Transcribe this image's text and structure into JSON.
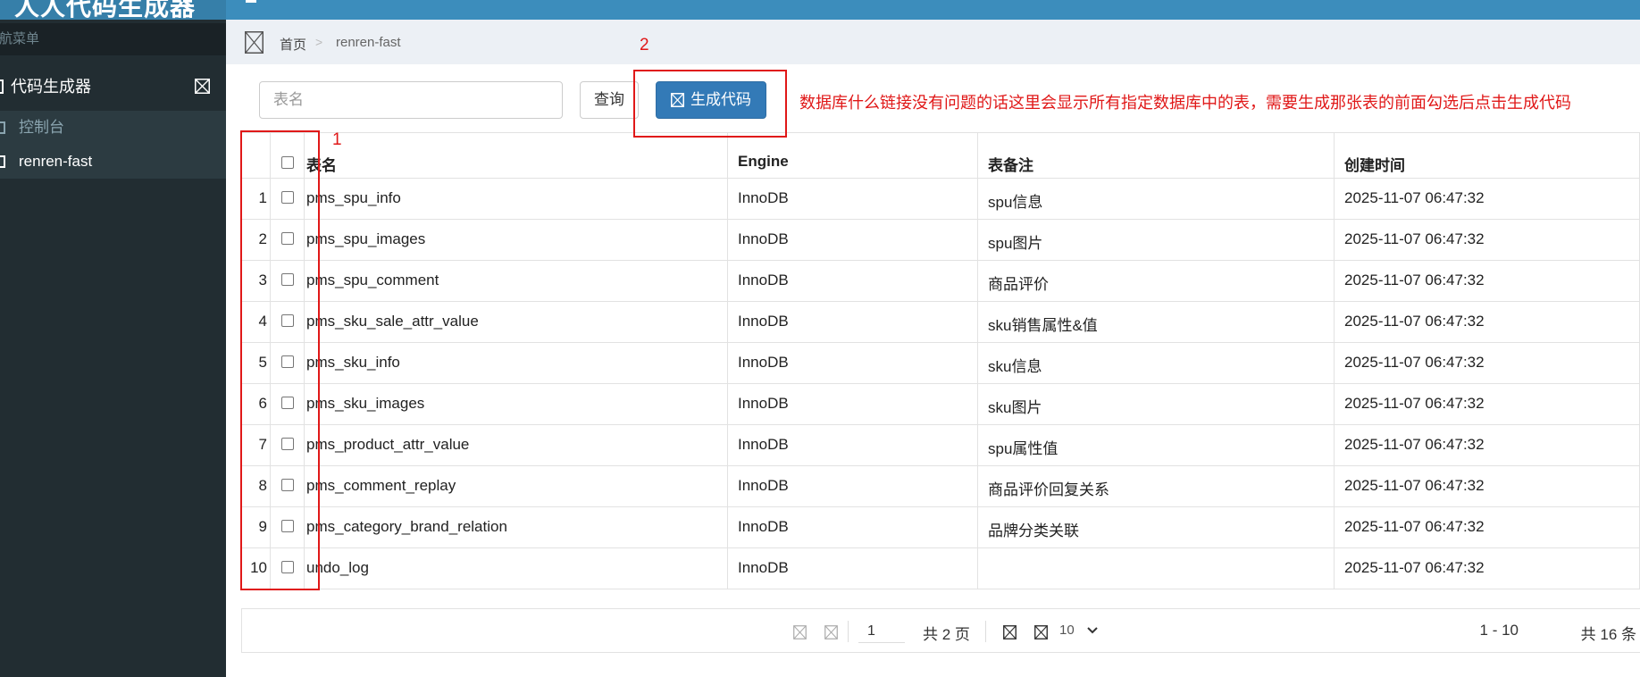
{
  "sidebar": {
    "brand": "人人代码生成器",
    "nav_header": "导航菜单",
    "group_label": "代码生成器",
    "items": [
      {
        "label": "控制台"
      },
      {
        "label": "renren-fast"
      }
    ]
  },
  "breadcrumb": {
    "home": "首页",
    "separator": ">",
    "current": "renren-fast"
  },
  "toolbar": {
    "search_placeholder": "表名",
    "query_label": "查询",
    "generate_label": "生成代码"
  },
  "annotations": {
    "num1": "1",
    "num2": "2",
    "note": "数据库什么链接没有问题的话这里会显示所有指定数据库中的表，需要生成那张表的前面勾选后点击生成代码",
    "color": "#e01818"
  },
  "table": {
    "headers": {
      "name": "表名",
      "engine": "Engine",
      "comment": "表备注",
      "created": "创建时间"
    },
    "rows": [
      {
        "num": "1",
        "name": "pms_spu_info",
        "engine": "InnoDB",
        "comment": "spu信息",
        "created": "2025-11-07 06:47:32"
      },
      {
        "num": "2",
        "name": "pms_spu_images",
        "engine": "InnoDB",
        "comment": "spu图片",
        "created": "2025-11-07 06:47:32"
      },
      {
        "num": "3",
        "name": "pms_spu_comment",
        "engine": "InnoDB",
        "comment": "商品评价",
        "created": "2025-11-07 06:47:32"
      },
      {
        "num": "4",
        "name": "pms_sku_sale_attr_value",
        "engine": "InnoDB",
        "comment": "sku销售属性&值",
        "created": "2025-11-07 06:47:32"
      },
      {
        "num": "5",
        "name": "pms_sku_info",
        "engine": "InnoDB",
        "comment": "sku信息",
        "created": "2025-11-07 06:47:32"
      },
      {
        "num": "6",
        "name": "pms_sku_images",
        "engine": "InnoDB",
        "comment": "sku图片",
        "created": "2025-11-07 06:47:32"
      },
      {
        "num": "7",
        "name": "pms_product_attr_value",
        "engine": "InnoDB",
        "comment": "spu属性值",
        "created": "2025-11-07 06:47:32"
      },
      {
        "num": "8",
        "name": "pms_comment_replay",
        "engine": "InnoDB",
        "comment": "商品评价回复关系",
        "created": "2025-11-07 06:47:32"
      },
      {
        "num": "9",
        "name": "pms_category_brand_relation",
        "engine": "InnoDB",
        "comment": "品牌分类关联",
        "created": "2025-11-07 06:47:32"
      },
      {
        "num": "10",
        "name": "undo_log",
        "engine": "InnoDB",
        "comment": "",
        "created": "2025-11-07 06:47:32"
      }
    ]
  },
  "pager": {
    "current_page": "1",
    "total_pages": "共 2 页",
    "page_size": "10",
    "range": "1 - 10",
    "total_count": "共 16 条"
  },
  "colors": {
    "sidebar_bg": "#222d32",
    "topbar_bg": "#3c8dbc",
    "primary_button": "#337ab7"
  }
}
